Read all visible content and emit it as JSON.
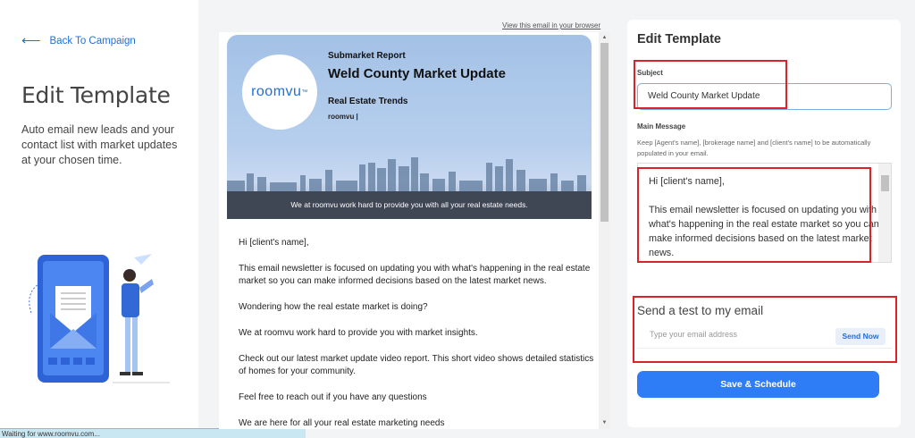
{
  "left": {
    "back_label": "Back To Campaign",
    "title": "Edit Template",
    "description": "Auto email new leads and your contact list with market updates at your chosen time."
  },
  "status_bar": {
    "text": "Waiting for www.roomvu.com..."
  },
  "preview": {
    "view_in_browser": "View this email in your browser",
    "banner": {
      "logo_text": "roomvu",
      "logo_mark": "™",
      "subtitle": "Submarket Report",
      "title": "Weld County Market Update",
      "section": "Real Estate Trends",
      "byline": "roomvu |",
      "footer": "We at roomvu work hard to provide you with all your real estate needs."
    },
    "body": [
      "Hi [client's name],",
      "This email newsletter is focused on updating you with what's happening in the real estate market so you can make informed decisions based on the latest market news.",
      "Wondering how the real estate market is doing?",
      "We at roomvu work hard to provide you with market insights.",
      "Check out our latest market update video report. This short video shows detailed statistics of homes for your community.",
      "Feel free to reach out if you have any questions",
      "We are here for all your real estate marketing needs"
    ]
  },
  "form": {
    "title": "Edit Template",
    "subject_label": "Subject",
    "subject_value": "Weld County Market Update",
    "main_message_label": "Main Message",
    "hint": "Keep [Agent's name], [brokerage name] and [client's name] to be automatically populated in your email.",
    "message_lines": [
      "Hi [client's name],",
      "This email newsletter is focused on updating you with what's happening in the real estate market so you can make informed decisions based on the latest market news."
    ],
    "test_title": "Send a test to my email",
    "test_placeholder": "Type your email address",
    "send_now_label": "Send Now",
    "save_label": "Save & Schedule"
  },
  "colors": {
    "accent": "#2f7df6",
    "link": "#1f6fd6",
    "highlight": "#d9222a",
    "banner_footer": "#3f4654"
  }
}
